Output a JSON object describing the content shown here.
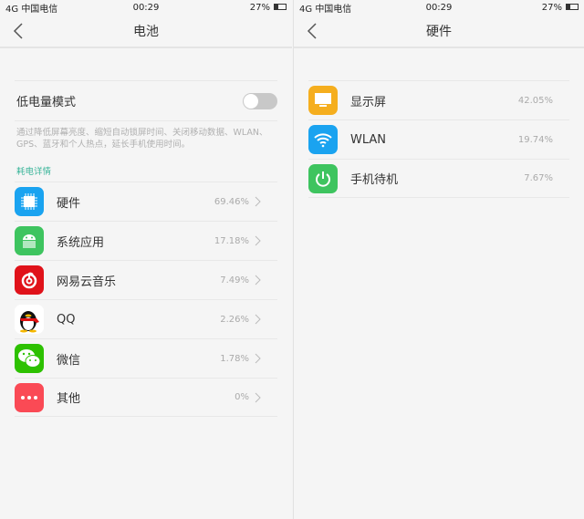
{
  "status": {
    "carrier": "中国电信",
    "signal": "4G",
    "time": "00:29",
    "battery": "27%"
  },
  "battery_page": {
    "title": "电池",
    "low_power_label": "低电量模式",
    "low_power_on": false,
    "description": "通过降低屏幕亮度、缩短自动锁屏时间、关闭移动数据、WLAN、GPS、蓝牙和个人热点，延长手机使用时间。",
    "section_label": "耗电详情",
    "items": [
      {
        "name": "硬件",
        "percent": "69.46%",
        "icon": "chip-icon",
        "color": "#1aa3f0"
      },
      {
        "name": "系统应用",
        "percent": "17.18%",
        "icon": "android-icon",
        "color": "#3ec45f"
      },
      {
        "name": "网易云音乐",
        "percent": "7.49%",
        "icon": "netease-music-icon",
        "color": "#e0121a"
      },
      {
        "name": "QQ",
        "percent": "2.26%",
        "icon": "qq-penguin-icon",
        "color": "#ffffff"
      },
      {
        "name": "微信",
        "percent": "1.78%",
        "icon": "wechat-icon",
        "color": "#2dc100"
      },
      {
        "name": "其他",
        "percent": "0%",
        "icon": "more-dots-icon",
        "color": "#fa4a55"
      }
    ]
  },
  "hardware_page": {
    "title": "硬件",
    "items": [
      {
        "name": "显示屏",
        "percent": "42.05%",
        "icon": "display-icon",
        "color": "#f5ae1e"
      },
      {
        "name": "WLAN",
        "percent": "19.74%",
        "icon": "wifi-icon",
        "color": "#1aa3f0"
      },
      {
        "name": "手机待机",
        "percent": "7.67%",
        "icon": "power-icon",
        "color": "#3ec45f"
      }
    ]
  }
}
